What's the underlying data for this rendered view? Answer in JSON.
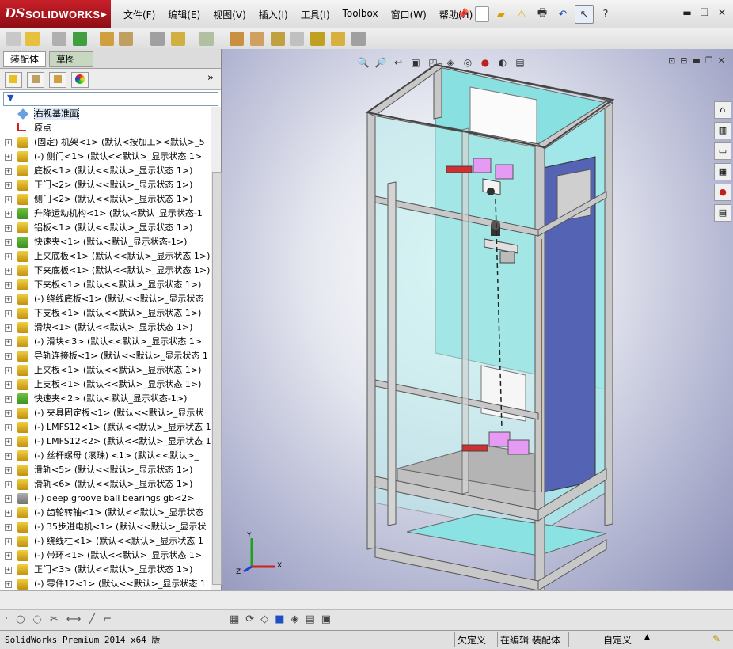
{
  "app": {
    "logo_ds": "DS",
    "logo_name": "SOLIDWORKS"
  },
  "menu": [
    "文件(F)",
    "编辑(E)",
    "视图(V)",
    "插入(I)",
    "工具(I)",
    "Toolbox",
    "窗口(W)",
    "帮助(H)"
  ],
  "panel": {
    "tabs": [
      "装配体",
      "草图"
    ],
    "overflow_label": "»"
  },
  "tree": [
    {
      "label": "右视基准面",
      "icon": "plane-icon",
      "expand": false,
      "highlight": true
    },
    {
      "label": "原点",
      "icon": "origin-icon",
      "expand": false
    },
    {
      "label": "(固定) 机架<1> (默认<按加工><默认>_5",
      "icon": "part-icon",
      "expand": true
    },
    {
      "label": "(-) 侧门<1> (默认<<默认>_显示状态 1>",
      "icon": "part-icon",
      "expand": true
    },
    {
      "label": "底板<1> (默认<<默认>_显示状态 1>)",
      "icon": "part-icon",
      "expand": true
    },
    {
      "label": "正门<2> (默认<<默认>_显示状态 1>)",
      "icon": "part-icon",
      "expand": true
    },
    {
      "label": "侧门<2> (默认<<默认>_显示状态 1>)",
      "icon": "part-icon",
      "expand": true
    },
    {
      "label": "升降运动机构<1> (默认<默认_显示状态-1",
      "icon": "assembly-icon",
      "expand": true
    },
    {
      "label": "铝板<1> (默认<<默认>_显示状态 1>)",
      "icon": "part-icon",
      "expand": true
    },
    {
      "label": "快速夹<1> (默认<默认_显示状态-1>)",
      "icon": "assembly-icon",
      "expand": true
    },
    {
      "label": "上夹底板<1> (默认<<默认>_显示状态 1>)",
      "icon": "part-icon",
      "expand": true
    },
    {
      "label": "下夹底板<1> (默认<<默认>_显示状态 1>)",
      "icon": "part-icon",
      "expand": true
    },
    {
      "label": "下夹板<1> (默认<<默认>_显示状态 1>)",
      "icon": "part-icon",
      "expand": true
    },
    {
      "label": "(-) 绕线底板<1> (默认<<默认>_显示状态",
      "icon": "part-icon",
      "expand": true
    },
    {
      "label": "下支板<1> (默认<<默认>_显示状态 1>)",
      "icon": "part-icon",
      "expand": true
    },
    {
      "label": "滑块<1> (默认<<默认>_显示状态 1>)",
      "icon": "part-icon",
      "expand": true
    },
    {
      "label": "(-) 滑块<3> (默认<<默认>_显示状态 1>",
      "icon": "part-icon",
      "expand": true
    },
    {
      "label": "导轨连接板<1> (默认<<默认>_显示状态 1",
      "icon": "part-icon",
      "expand": true
    },
    {
      "label": "上夹板<1> (默认<<默认>_显示状态 1>)",
      "icon": "part-icon",
      "expand": true
    },
    {
      "label": "上支板<1> (默认<<默认>_显示状态 1>)",
      "icon": "part-icon",
      "expand": true
    },
    {
      "label": "快速夹<2> (默认<默认_显示状态-1>)",
      "icon": "assembly-icon",
      "expand": true
    },
    {
      "label": "(-) 夹具固定板<1> (默认<<默认>_显示状",
      "icon": "part-icon",
      "expand": true
    },
    {
      "label": "(-) LMFS12<1> (默认<<默认>_显示状态 1",
      "icon": "part-icon",
      "expand": true
    },
    {
      "label": "(-) LMFS12<2> (默认<<默认>_显示状态 1",
      "icon": "part-icon",
      "expand": true
    },
    {
      "label": "(-) 丝杆螺母 (滚珠) <1> (默认<<默认>_",
      "icon": "part-icon",
      "expand": true
    },
    {
      "label": "滑轨<5> (默认<<默认>_显示状态 1>)",
      "icon": "part-icon",
      "expand": true
    },
    {
      "label": "滑轨<6> (默认<<默认>_显示状态 1>)",
      "icon": "part-icon",
      "expand": true
    },
    {
      "label": "(-) deep groove ball bearings gb<2>",
      "icon": "toolbox-icon",
      "expand": true
    },
    {
      "label": "(-) 齿轮转轴<1> (默认<<默认>_显示状态",
      "icon": "part-icon",
      "expand": true
    },
    {
      "label": "(-) 35步进电机<1> (默认<<默认>_显示状",
      "icon": "part-icon",
      "expand": true
    },
    {
      "label": "(-) 绕线柱<1> (默认<<默认>_显示状态 1",
      "icon": "part-icon",
      "expand": true
    },
    {
      "label": "(-) 带环<1> (默认<<默认>_显示状态 1>",
      "icon": "part-icon",
      "expand": true
    },
    {
      "label": "正门<3> (默认<<默认>_显示状态 1>)",
      "icon": "part-icon",
      "expand": true
    },
    {
      "label": "(-) 零件12<1> (默认<<默认>_显示状态 1",
      "icon": "part-icon",
      "expand": true
    }
  ],
  "viewport": {
    "triad_x": "X",
    "triad_y": "Y",
    "triad_z": "Z"
  },
  "status": {
    "product": "SolidWorks Premium 2014 x64 版",
    "underdefined": "欠定义",
    "editing": "在编辑 装配体",
    "custom": "自定义",
    "custom_arrow": "▲"
  },
  "colors": {
    "logo_red": "#b0121c",
    "frame_gray": "#bcbcbc",
    "glass_cyan": "#7fe0e0",
    "rail_blue": "#5a68b8",
    "clamp_magenta": "#e080f0"
  }
}
